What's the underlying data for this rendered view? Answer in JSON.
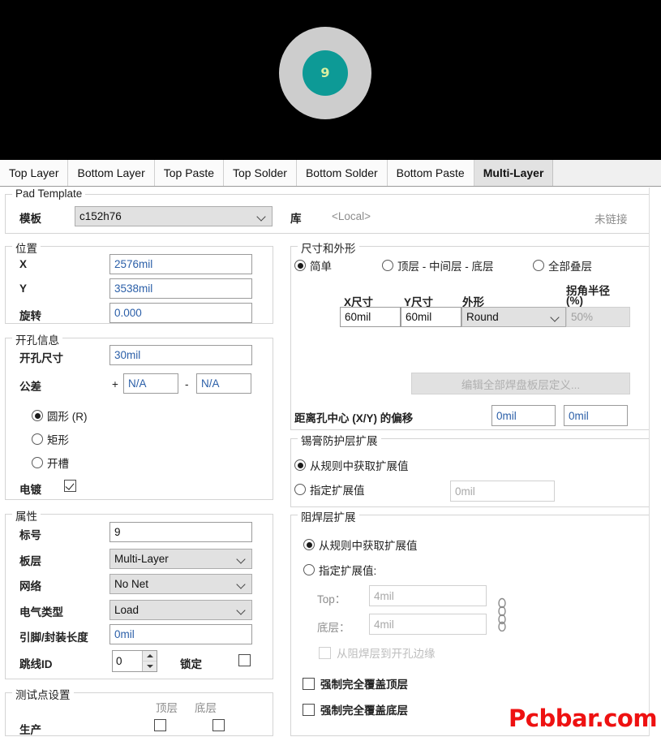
{
  "preview": {
    "designator": "9",
    "pad_color": "#0d9a96",
    "hole_ring_color": "#cdcdcd",
    "designator_color": "#d8f0a0",
    "background": "#000000"
  },
  "tabs": [
    {
      "label": "Top Layer",
      "active": false
    },
    {
      "label": "Bottom Layer",
      "active": false
    },
    {
      "label": "Top Paste",
      "active": false
    },
    {
      "label": "Top Solder",
      "active": false
    },
    {
      "label": "Bottom Solder",
      "active": false
    },
    {
      "label": "Bottom Paste",
      "active": false
    },
    {
      "label": "Multi-Layer",
      "active": true
    }
  ],
  "pad_template": {
    "group_title": "Pad Template",
    "template_label": "模板",
    "template_value": "c152h76",
    "library_label": "库",
    "library_value": "<Local>",
    "link_status": "未链接"
  },
  "location": {
    "group_title": "位置",
    "x_label": "X",
    "x_value": "2576mil",
    "y_label": "Y",
    "y_value": "3538mil",
    "rotation_label": "旋转",
    "rotation_value": "0.000"
  },
  "hole_info": {
    "group_title": "开孔信息",
    "hole_size_label": "开孔尺寸",
    "hole_size_value": "30mil",
    "tolerance_label": "公差",
    "tolerance_plus_sign": "+",
    "tolerance_plus_value": "N/A",
    "tolerance_minus_sign": "-",
    "tolerance_minus_value": "N/A",
    "shape_round": "圆形 (R)",
    "shape_rect": "矩形",
    "shape_slot": "开槽",
    "shape_selected": "圆形 (R)",
    "plated_label": "电镀",
    "plated_checked": true
  },
  "properties": {
    "group_title": "属性",
    "designator_label": "标号",
    "designator_value": "9",
    "layer_label": "板层",
    "layer_value": "Multi-Layer",
    "net_label": "网络",
    "net_value": "No Net",
    "electrical_type_label": "电气类型",
    "electrical_type_value": "Load",
    "pin_package_length_label": "引脚/封装长度",
    "pin_package_length_value": "0mil",
    "jumper_id_label": "跳线ID",
    "jumper_id_value": "0",
    "locked_label": "锁定",
    "locked_checked": false
  },
  "testpoint": {
    "group_title": "测试点设置",
    "top_label": "顶层",
    "bottom_label": "底层",
    "fabrication_label": "生产",
    "fab_top_checked": false,
    "fab_bottom_checked": false
  },
  "size_shape": {
    "group_title": "尺寸和外形",
    "mode_simple": "简单",
    "mode_tmb": "顶层 - 中间层 - 底层",
    "mode_full": "全部叠层",
    "mode_selected": "简单",
    "col_x": "X尺寸",
    "col_y": "Y尺寸",
    "col_shape": "外形",
    "col_corner_radius_l1": "拐角半径",
    "col_corner_radius_l2": "(%)",
    "x_size": "60mil",
    "y_size": "60mil",
    "shape": "Round",
    "corner_radius": "50%",
    "edit_all_layers_button": "编辑全部焊盘板层定义...",
    "offset_label": "距离孔中心 (X/Y) 的偏移",
    "offset_x": "0mil",
    "offset_y": "0mil"
  },
  "paste_mask": {
    "group_title": "锡膏防护层扩展",
    "from_rules_label": "从规则中获取扩展值",
    "specify_label": "指定扩展值",
    "selected": "从规则中获取扩展值",
    "specify_value": "0mil"
  },
  "solder_mask": {
    "group_title": "阻焊层扩展",
    "from_rules_label": "从规则中获取扩展值",
    "specify_label": "指定扩展值:",
    "selected": "从规则中获取扩展值",
    "top_label": "Top：",
    "top_value": "4mil",
    "bottom_label": "底层：",
    "bottom_value": "4mil",
    "tented_label": "从阻焊层到开孔边缘",
    "tented_checked": false,
    "force_top_label": "强制完全覆盖顶层",
    "force_top_checked": false,
    "force_bottom_label": "强制完全覆盖底层",
    "force_bottom_checked": false,
    "link_icon": "chain-link-icon"
  },
  "watermark": {
    "text": "Pcbbar.com",
    "color": "#ee1111"
  }
}
